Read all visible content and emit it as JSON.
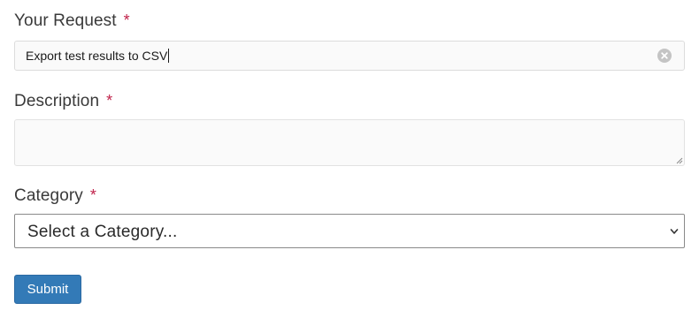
{
  "form": {
    "request": {
      "label": "Your Request",
      "required_marker": "*",
      "value": "Export test results to CSV",
      "clear_icon": "clear-circle-icon"
    },
    "description": {
      "label": "Description",
      "required_marker": "*",
      "value": ""
    },
    "category": {
      "label": "Category",
      "required_marker": "*",
      "selected": "Select a Category...",
      "chevron_icon": "chevron-down-icon"
    },
    "submit_label": "Submit"
  },
  "colors": {
    "required": "#c0224a",
    "submit_bg": "#337ab7",
    "input_bg": "#fafafa"
  }
}
